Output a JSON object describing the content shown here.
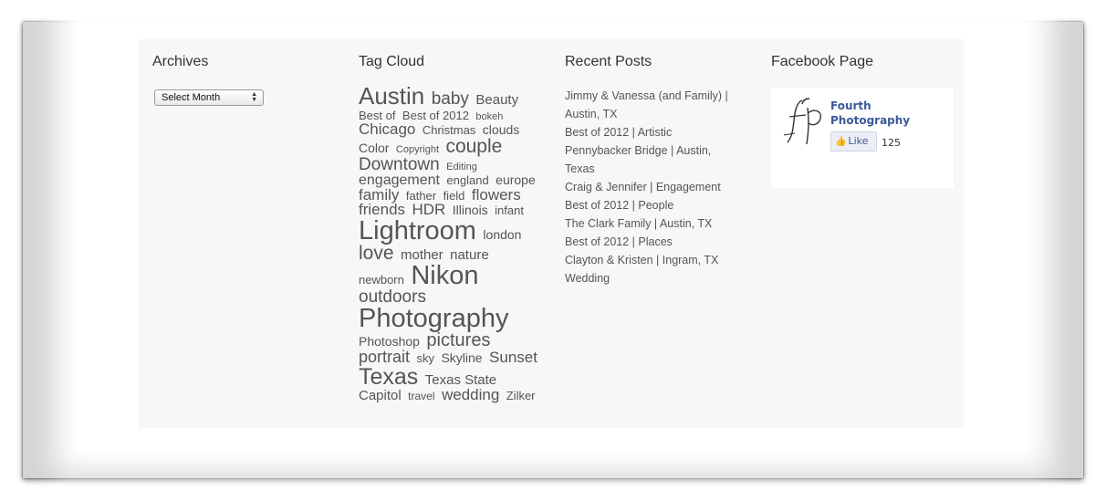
{
  "archives": {
    "title": "Archives",
    "select_value": "Select Month"
  },
  "tag_cloud": {
    "title": "Tag Cloud",
    "tags": [
      {
        "label": "Austin",
        "size": 26
      },
      {
        "label": "baby",
        "size": 19
      },
      {
        "label": "Beauty",
        "size": 15
      },
      {
        "label": "Best of",
        "size": 13
      },
      {
        "label": "Best of 2012",
        "size": 13
      },
      {
        "label": "bokeh",
        "size": 11
      },
      {
        "label": "Chicago",
        "size": 17
      },
      {
        "label": "Christmas",
        "size": 13
      },
      {
        "label": "clouds",
        "size": 14
      },
      {
        "label": "Color",
        "size": 14
      },
      {
        "label": "Copyright",
        "size": 11
      },
      {
        "label": "couple",
        "size": 21
      },
      {
        "label": "Downtown",
        "size": 19
      },
      {
        "label": "Editing",
        "size": 11
      },
      {
        "label": "engagement",
        "size": 16
      },
      {
        "label": "england",
        "size": 13
      },
      {
        "label": "europe",
        "size": 14
      },
      {
        "label": "family",
        "size": 17
      },
      {
        "label": "father",
        "size": 13
      },
      {
        "label": "field",
        "size": 13
      },
      {
        "label": "flowers",
        "size": 17
      },
      {
        "label": "friends",
        "size": 17
      },
      {
        "label": "HDR",
        "size": 17
      },
      {
        "label": "Illinois",
        "size": 14
      },
      {
        "label": "infant",
        "size": 13
      },
      {
        "label": "Lightroom",
        "size": 29
      },
      {
        "label": "london",
        "size": 14
      },
      {
        "label": "love",
        "size": 21
      },
      {
        "label": "mother",
        "size": 15
      },
      {
        "label": "nature",
        "size": 15
      },
      {
        "label": "newborn",
        "size": 13
      },
      {
        "label": "Nikon",
        "size": 29
      },
      {
        "label": "outdoors",
        "size": 19
      },
      {
        "label": "Photography",
        "size": 29
      },
      {
        "label": "Photoshop",
        "size": 14
      },
      {
        "label": "pictures",
        "size": 20
      },
      {
        "label": "portrait",
        "size": 18
      },
      {
        "label": "sky",
        "size": 13
      },
      {
        "label": "Skyline",
        "size": 14
      },
      {
        "label": "Sunset",
        "size": 17
      },
      {
        "label": "Texas",
        "size": 25
      },
      {
        "label": "Texas State Capitol",
        "size": 15
      },
      {
        "label": "travel",
        "size": 12
      },
      {
        "label": "wedding",
        "size": 17
      },
      {
        "label": "Zilker",
        "size": 13
      }
    ]
  },
  "recent_posts": {
    "title": "Recent Posts",
    "items": [
      "Jimmy & Vanessa (and Family) | Austin, TX",
      "Best of 2012 | Artistic",
      "Pennybacker Bridge | Austin, Texas",
      "Craig & Jennifer | Engagement",
      "Best of 2012 | People",
      "The Clark Family | Austin, TX",
      "Best of 2012 | Places",
      "Clayton & Kristen | Ingram, TX Wedding"
    ]
  },
  "facebook": {
    "title": "Facebook Page",
    "page_name": "Fourth Photography",
    "like_label": "Like",
    "like_count": "125",
    "logo_icon": "fp-monogram-icon",
    "like_color": "#3b5998"
  }
}
